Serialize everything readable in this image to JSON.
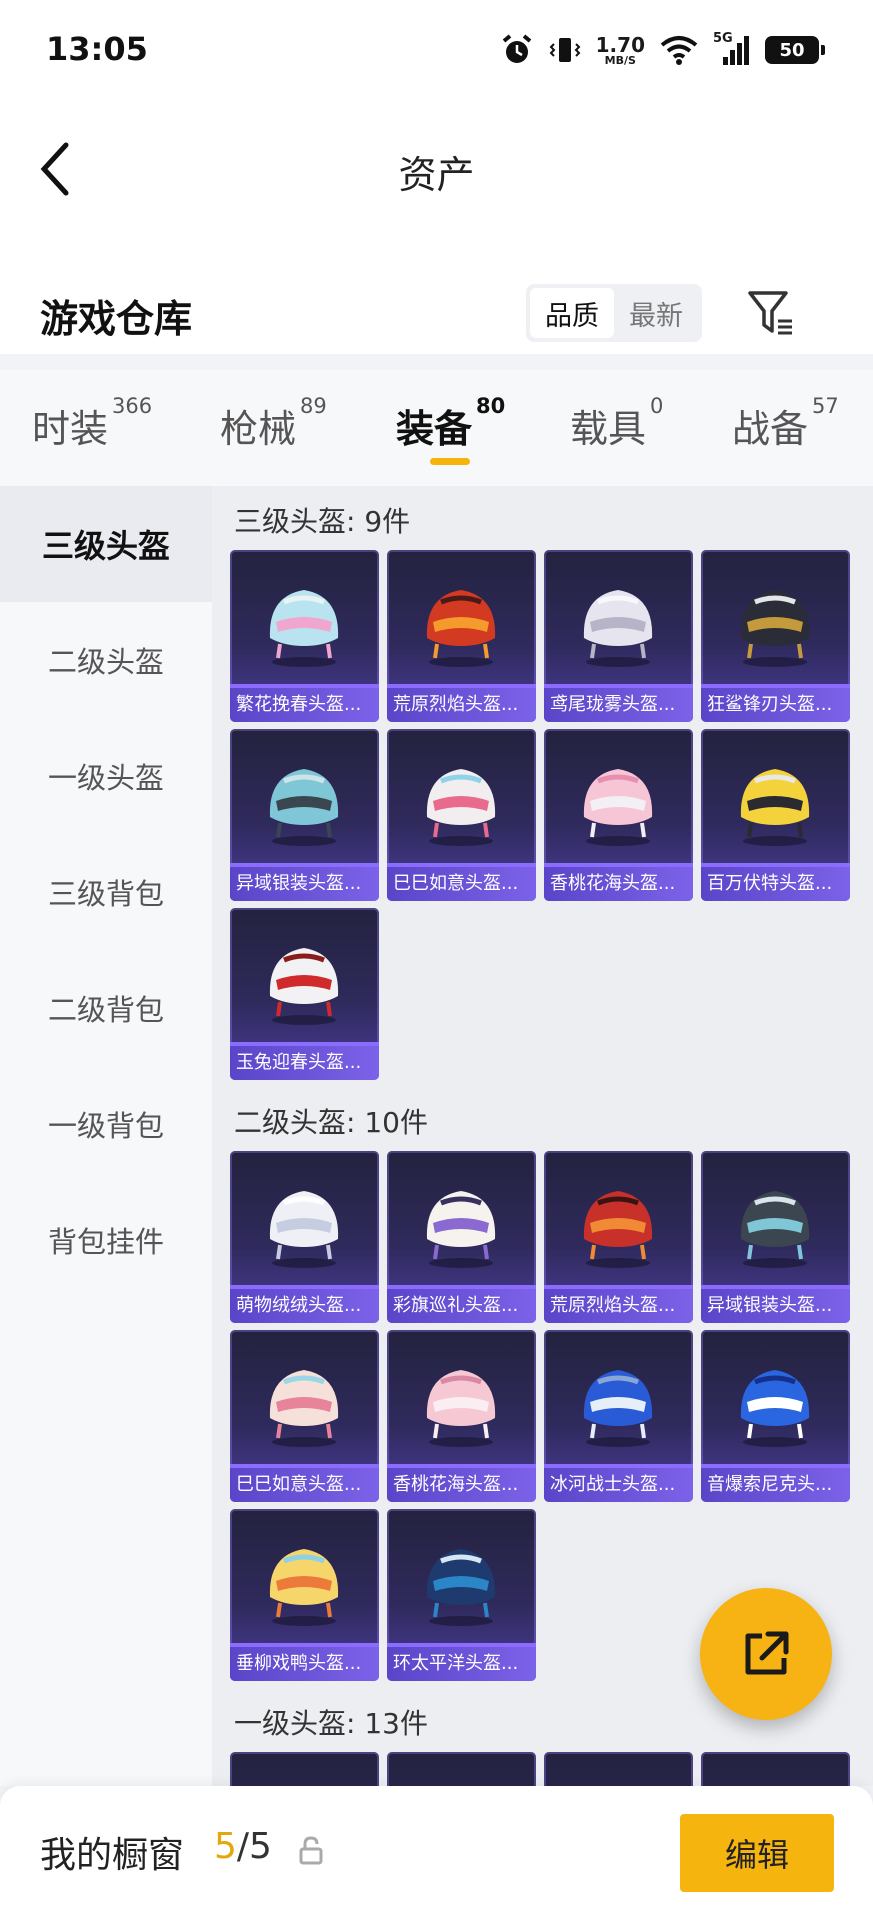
{
  "status": {
    "time": "13:05",
    "net_speed_value": "1.70",
    "net_speed_unit": "MB/S",
    "network_type": "5G",
    "battery": "50",
    "icons": [
      "alarm-icon",
      "vibrate-icon",
      "wifi-icon",
      "signal-icon",
      "battery-icon"
    ]
  },
  "header": {
    "title": "资产",
    "section_title": "游戏仓库",
    "sort_options": [
      {
        "label": "品质",
        "active": true
      },
      {
        "label": "最新",
        "active": false
      }
    ]
  },
  "tabs": [
    {
      "label": "时装",
      "count": "366",
      "active": false
    },
    {
      "label": "枪械",
      "count": "89",
      "active": false
    },
    {
      "label": "装备",
      "count": "80",
      "active": true
    },
    {
      "label": "载具",
      "count": "0",
      "active": false
    },
    {
      "label": "战备",
      "count": "57",
      "active": false
    }
  ],
  "sidebar": {
    "items": [
      {
        "label": "三级头盔",
        "active": true
      },
      {
        "label": "二级头盔",
        "active": false
      },
      {
        "label": "一级头盔",
        "active": false
      },
      {
        "label": "三级背包",
        "active": false
      },
      {
        "label": "二级背包",
        "active": false
      },
      {
        "label": "一级背包",
        "active": false
      },
      {
        "label": "背包挂件",
        "active": false
      }
    ]
  },
  "groups": [
    {
      "heading": "三级头盔: 9件",
      "items": [
        {
          "name": "繁花挽春头盔...",
          "colors": [
            "#b9e4ef",
            "#f0a6cf",
            "#e9f2f5"
          ]
        },
        {
          "name": "荒原烈焰头盔...",
          "colors": [
            "#d23a22",
            "#f59a2c",
            "#4a1a18"
          ]
        },
        {
          "name": "鸢尾珑雾头盔...",
          "colors": [
            "#e6e4ee",
            "#b8b4c8",
            "#f8f8fc"
          ]
        },
        {
          "name": "狂鲨锋刃头盔...",
          "colors": [
            "#2a2c38",
            "#c59a3c",
            "#e6e6ea"
          ]
        },
        {
          "name": "异域银装头盔...",
          "colors": [
            "#7fc6d6",
            "#3a4650",
            "#cfe4ea"
          ]
        },
        {
          "name": "巳巳如意头盔...",
          "colors": [
            "#f2eef0",
            "#e86a8c",
            "#8fd3ea"
          ]
        },
        {
          "name": "香桃花海头盔...",
          "colors": [
            "#f6c6d6",
            "#f2f0f4",
            "#e78fae"
          ]
        },
        {
          "name": "百万伏特头盔...",
          "colors": [
            "#f4d23c",
            "#2a2a30",
            "#e8e8e8"
          ]
        },
        {
          "name": "玉兔迎春头盔...",
          "colors": [
            "#f2f2f4",
            "#d12a2a",
            "#8a1c1c"
          ]
        }
      ]
    },
    {
      "heading": "二级头盔: 10件",
      "items": [
        {
          "name": "萌物绒绒头盔...",
          "colors": [
            "#eef0f6",
            "#c6cde0",
            "#ffffff"
          ]
        },
        {
          "name": "彩旗巡礼头盔...",
          "colors": [
            "#f6f2ee",
            "#8a6ad0",
            "#3a3060"
          ]
        },
        {
          "name": "荒原烈焰头盔...",
          "colors": [
            "#c8302a",
            "#f08a34",
            "#3a1414"
          ]
        },
        {
          "name": "异域银装头盔...",
          "colors": [
            "#3c4650",
            "#7fc6d6",
            "#d6e6ea"
          ]
        },
        {
          "name": "巳巳如意头盔...",
          "colors": [
            "#f6e0da",
            "#e8849a",
            "#9ad6ea"
          ]
        },
        {
          "name": "香桃花海头盔...",
          "colors": [
            "#f6c8d4",
            "#fbeef2",
            "#d88aa4"
          ]
        },
        {
          "name": "冰河战士头盔...",
          "colors": [
            "#2a5bd6",
            "#e6eef8",
            "#8aa6d6"
          ]
        },
        {
          "name": "音爆索尼克头...",
          "colors": [
            "#2a66e0",
            "#ffffff",
            "#14308a"
          ]
        },
        {
          "name": "垂柳戏鸭头盔...",
          "colors": [
            "#f6d66a",
            "#ec7a3a",
            "#8fd0e6"
          ]
        },
        {
          "name": "环太平洋头盔...",
          "colors": [
            "#1e3a6e",
            "#2a86c6",
            "#d6e6f2"
          ]
        }
      ]
    },
    {
      "heading": "一级头盔: 13件",
      "items": [
        {
          "name": "",
          "colors": [
            "#2a2a3e",
            "#2a2a3e",
            "#2a2a3e"
          ]
        },
        {
          "name": "",
          "colors": [
            "#2a2a3e",
            "#2a2a3e",
            "#2a2a3e"
          ]
        },
        {
          "name": "",
          "colors": [
            "#2a2a3e",
            "#2a2a3e",
            "#2a2a3e"
          ]
        },
        {
          "name": "",
          "colors": [
            "#2a2a3e",
            "#2a2a3e",
            "#2a2a3e"
          ]
        }
      ]
    }
  ],
  "bottom": {
    "window_label": "我的橱窗",
    "window_current": "5",
    "window_total": "/5",
    "edit_label": "编辑"
  },
  "accent_color": "#f6b50e"
}
